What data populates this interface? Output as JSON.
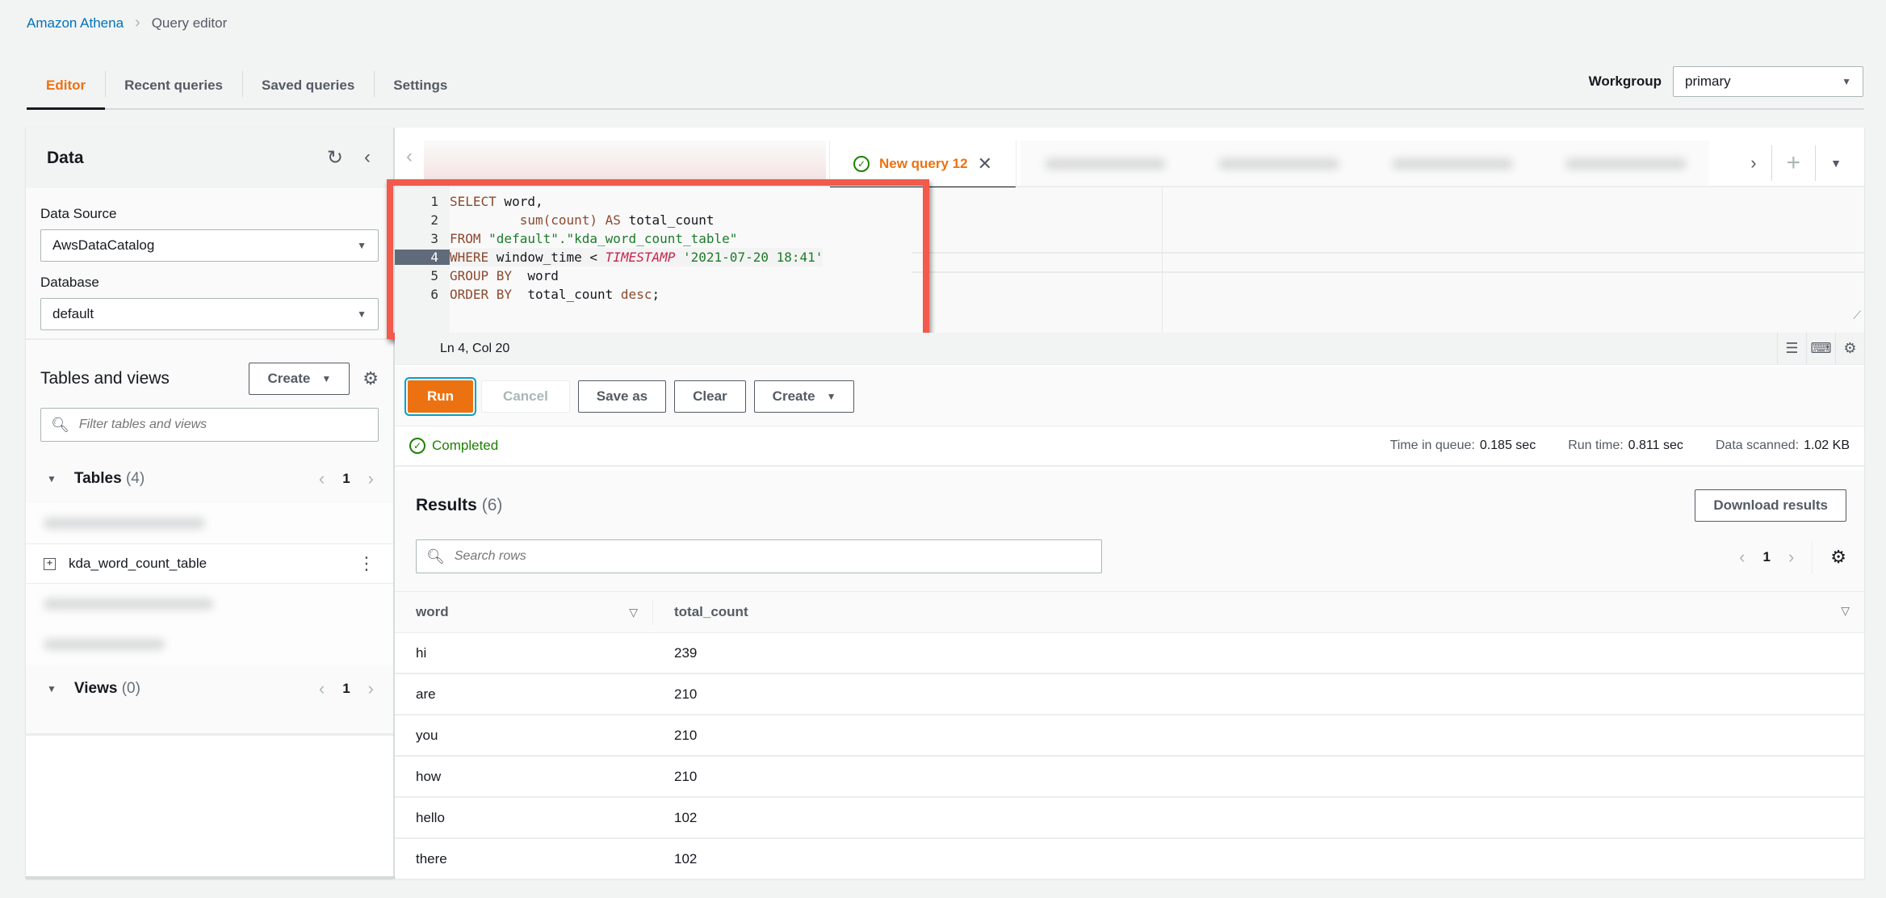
{
  "breadcrumb": {
    "parent": "Amazon Athena",
    "separator": ">",
    "current": "Query editor"
  },
  "top_tabs": [
    {
      "label": "Editor",
      "active": true
    },
    {
      "label": "Recent queries",
      "active": false
    },
    {
      "label": "Saved queries",
      "active": false
    },
    {
      "label": "Settings",
      "active": false
    }
  ],
  "workgroup": {
    "label": "Workgroup",
    "value": "primary"
  },
  "data_panel": {
    "title": "Data",
    "data_source_label": "Data Source",
    "data_source_value": "AwsDataCatalog",
    "database_label": "Database",
    "database_value": "default",
    "tables_and_views_title": "Tables and views",
    "create_label": "Create",
    "filter_placeholder": "Filter tables and views",
    "tables": {
      "label": "Tables",
      "count": "(4)",
      "page": "1",
      "visible_item": "kda_word_count_table"
    },
    "views": {
      "label": "Views",
      "count": "(0)",
      "page": "1"
    }
  },
  "query_tabs": {
    "active_label": "New query 12",
    "status": "completed"
  },
  "editor": {
    "lines": [
      {
        "n": "1"
      },
      {
        "n": "2"
      },
      {
        "n": "3"
      },
      {
        "n": "4"
      },
      {
        "n": "5"
      },
      {
        "n": "6"
      }
    ],
    "tokens": {
      "l1_kw": "SELECT",
      "l1_rest": " word,",
      "l2_indent": "         ",
      "l2_fn": "sum(count)",
      "l2_kw": " AS",
      "l2_rest": " total_count",
      "l3_kw": "FROM",
      "l3_str": " \"default\".\"kda_word_count_table\"",
      "l4_kw": "WHERE",
      "l4_rest": " window_time < ",
      "l4_ts": "TIMESTAMP",
      "l4_str": " '2021-07-20 18:41'",
      "l5_kw": "GROUP BY",
      "l5_rest": "  word",
      "l6_kw": "ORDER BY",
      "l6_rest": "  total_count ",
      "l6_kw2": "desc",
      "l6_end": ";"
    },
    "cursor_position": "Ln 4, Col 20"
  },
  "actions": {
    "run": "Run",
    "cancel": "Cancel",
    "save_as": "Save as",
    "clear": "Clear",
    "create": "Create"
  },
  "execution": {
    "status": "Completed",
    "time_in_queue_label": "Time in queue:",
    "time_in_queue": "0.185 sec",
    "run_time_label": "Run time:",
    "run_time": "0.811 sec",
    "data_scanned_label": "Data scanned:",
    "data_scanned": "1.02 KB"
  },
  "results": {
    "title": "Results",
    "count": "(6)",
    "download_label": "Download results",
    "search_placeholder": "Search rows",
    "page": "1",
    "columns": [
      "word",
      "total_count"
    ],
    "rows": [
      [
        "hi",
        "239"
      ],
      [
        "are",
        "210"
      ],
      [
        "you",
        "210"
      ],
      [
        "how",
        "210"
      ],
      [
        "hello",
        "102"
      ],
      [
        "there",
        "102"
      ]
    ]
  },
  "colors": {
    "accent": "#ec7211",
    "link": "#0073bb",
    "success": "#1d8102",
    "highlight_box": "#f25a4b"
  }
}
